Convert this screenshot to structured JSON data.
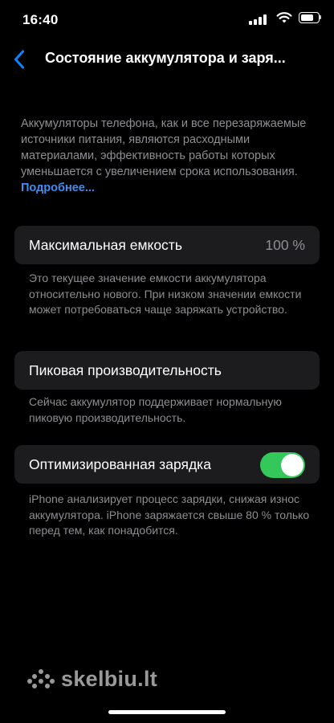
{
  "status_bar": {
    "time": "16:40",
    "icons": [
      "cellular-signal-icon",
      "wifi-icon",
      "battery-icon"
    ],
    "battery_level": 0.85
  },
  "nav": {
    "back_icon": "chevron-left-icon",
    "title": "Состояние аккумулятора и заря..."
  },
  "intro": {
    "text": "Аккумуляторы телефона, как и все перезаряжаемые источники питания, являются расходными материалами, эффективность работы которых уменьшается с увеличением срока использования.",
    "link": "Подробнее..."
  },
  "max_capacity": {
    "label": "Максимальная емкость",
    "value": "100 %",
    "footnote": "Это текущее значение емкости аккумулятора относительно нового. При низком значении емкости может потребоваться чаще заряжать устройство."
  },
  "peak_performance": {
    "label": "Пиковая производительность",
    "footnote": "Сейчас аккумулятор поддерживает нормальную пиковую производительность."
  },
  "optimized_charging": {
    "label": "Оптимизированная зарядка",
    "enabled": true,
    "footnote": "iPhone анализирует процесс зарядки, снижая износ аккумулятора. iPhone заряжается свыше 80 % только перед тем, как понадобится."
  },
  "watermark": {
    "text": "skelbiu.lt"
  },
  "colors": {
    "background": "#000000",
    "card": "#1c1c1e",
    "secondary_text": "#8e8e93",
    "link": "#3d8ef5",
    "accent_back": "#0a84ff",
    "toggle_on": "#34c759"
  }
}
